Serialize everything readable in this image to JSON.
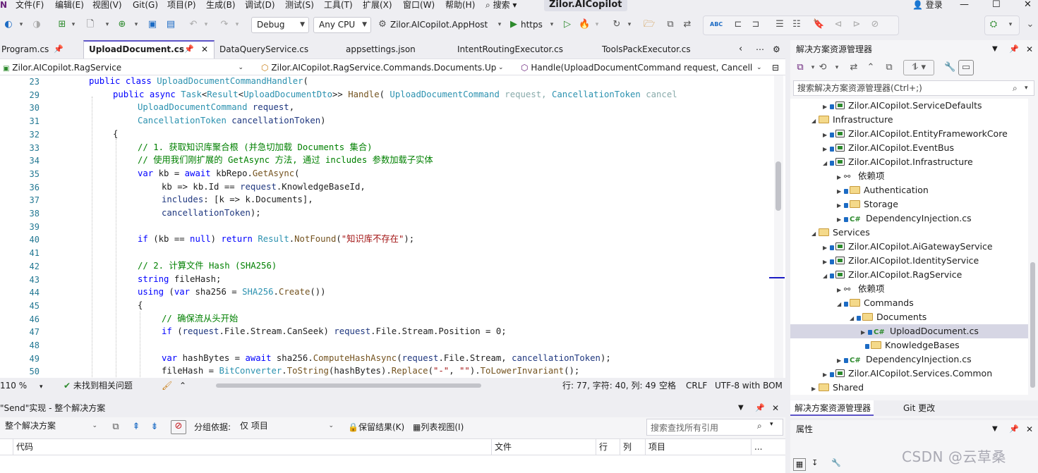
{
  "menu": {
    "items": [
      "文件(F)",
      "编辑(E)",
      "视图(V)",
      "Git(G)",
      "项目(P)",
      "生成(B)",
      "调试(D)",
      "测试(S)",
      "工具(T)",
      "扩展(X)",
      "窗口(W)",
      "帮助(H)"
    ],
    "search": "搜索",
    "app_title": "Zilor.AICopilot",
    "login": "登录"
  },
  "toolbar": {
    "config": "Debug",
    "platform": "Any CPU",
    "startup": "Zilor.AICopilot.AppHost",
    "run_profile": "https"
  },
  "tabs": [
    {
      "label": "Program.cs",
      "active": false
    },
    {
      "label": "UploadDocument.cs",
      "active": true
    },
    {
      "label": "DataQueryService.cs",
      "active": false
    },
    {
      "label": "appsettings.json",
      "active": false
    },
    {
      "label": "IntentRoutingExecutor.cs",
      "active": false
    },
    {
      "label": "ToolsPackExecutor.cs",
      "active": false
    }
  ],
  "nav": {
    "project": "Zilor.AICopilot.RagService",
    "type": "Zilor.AICopilot.RagService.Commands.Documents.Up",
    "member": "Handle(UploadDocumentCommand request, Cancell"
  },
  "code": {
    "line_numbers": [
      "23",
      "29",
      "30",
      "31",
      "32",
      "33",
      "34",
      "35",
      "36",
      "37",
      "38",
      "39",
      "40",
      "41",
      "42",
      "43",
      "44",
      "45",
      "46",
      "47",
      "48",
      "49",
      "50"
    ]
  },
  "status_editor": {
    "zoom": "110 %",
    "issues": "未找到相关问题",
    "position": "行: 77, 字符: 40, 列: 49",
    "whitespace": "空格",
    "eol": "CRLF",
    "encoding": "UTF-8 with BOM"
  },
  "refs": {
    "title": "\"Send\"实现 - 整个解决方案",
    "scope": "整个解决方案",
    "group_label": "分组依据:",
    "group_value": "仅 项目",
    "keep_results": "保留结果(K)",
    "list_view": "列表视图(I)",
    "search_placeholder": "搜索查找所有引用",
    "columns": [
      "代码",
      "文件",
      "行",
      "列",
      "项目",
      "..."
    ]
  },
  "solution_explorer": {
    "title": "解决方案资源管理器",
    "search_placeholder": "搜索解决方案资源管理器(Ctrl+;)",
    "nodes": [
      {
        "label": "Zilor.AICopilot.ServiceDefaults",
        "kind": "project"
      },
      {
        "label": "Infrastructure",
        "kind": "folder"
      },
      {
        "label": "Zilor.AICopilot.EntityFrameworkCore",
        "kind": "project"
      },
      {
        "label": "Zilor.AICopilot.EventBus",
        "kind": "project"
      },
      {
        "label": "Zilor.AICopilot.Infrastructure",
        "kind": "project"
      },
      {
        "label": "依赖项",
        "kind": "deps"
      },
      {
        "label": "Authentication",
        "kind": "folder"
      },
      {
        "label": "Storage",
        "kind": "folder"
      },
      {
        "label": "DependencyInjection.cs",
        "kind": "cs"
      },
      {
        "label": "Services",
        "kind": "folder"
      },
      {
        "label": "Zilor.AICopilot.AiGatewayService",
        "kind": "project"
      },
      {
        "label": "Zilor.AICopilot.IdentityService",
        "kind": "project"
      },
      {
        "label": "Zilor.AICopilot.RagService",
        "kind": "project"
      },
      {
        "label": "依赖项",
        "kind": "deps"
      },
      {
        "label": "Commands",
        "kind": "folder"
      },
      {
        "label": "Documents",
        "kind": "folder"
      },
      {
        "label": "UploadDocument.cs",
        "kind": "cs"
      },
      {
        "label": "KnowledgeBases",
        "kind": "folder"
      },
      {
        "label": "DependencyInjection.cs",
        "kind": "cs"
      },
      {
        "label": "Zilor.AICopilot.Services.Common",
        "kind": "project"
      },
      {
        "label": "Shared",
        "kind": "folder"
      }
    ],
    "tab_solution": "解决方案资源管理器",
    "tab_git": "Git 更改"
  },
  "properties": {
    "title": "属性"
  },
  "watermark": "CSDN @云草桑",
  "colors": {
    "accent": "#5d54c8",
    "keyword": "#0000ff",
    "type": "#2b91af",
    "comment": "#008000",
    "string": "#a31515"
  }
}
